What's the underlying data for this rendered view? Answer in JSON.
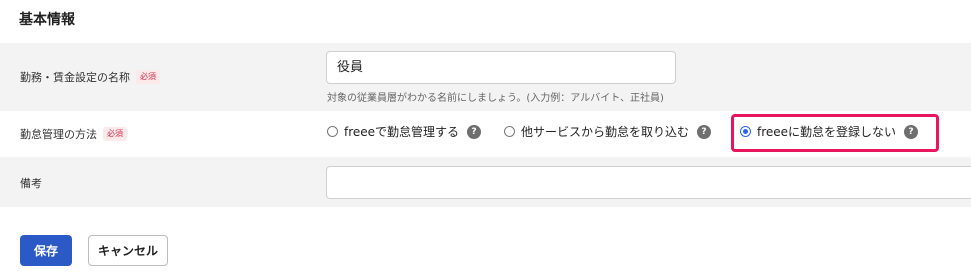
{
  "section": {
    "title": "基本情報"
  },
  "fields": {
    "name": {
      "label": "勤務・賃金設定の名称",
      "required_badge": "必須",
      "value": "役員",
      "hint": "対象の従業員層がわかる名前にしましょう。(入力例：アルバイト、正社員)"
    },
    "method": {
      "label": "勤怠管理の方法",
      "required_badge": "必須",
      "options": [
        {
          "label": "freeeで勤怠管理する",
          "checked": false
        },
        {
          "label": "他サービスから勤怠を取り込む",
          "checked": false
        },
        {
          "label": "freeeに勤怠を登録しない",
          "checked": true
        }
      ],
      "help_icon": "?"
    },
    "notes": {
      "label": "備考",
      "value": ""
    }
  },
  "buttons": {
    "save": "保存",
    "cancel": "キャンセル"
  },
  "colors": {
    "primary": "#2b5ac7",
    "highlight": "#e8175d",
    "required_badge_bg": "#fde8ea",
    "required_badge_text": "#d0304a"
  }
}
